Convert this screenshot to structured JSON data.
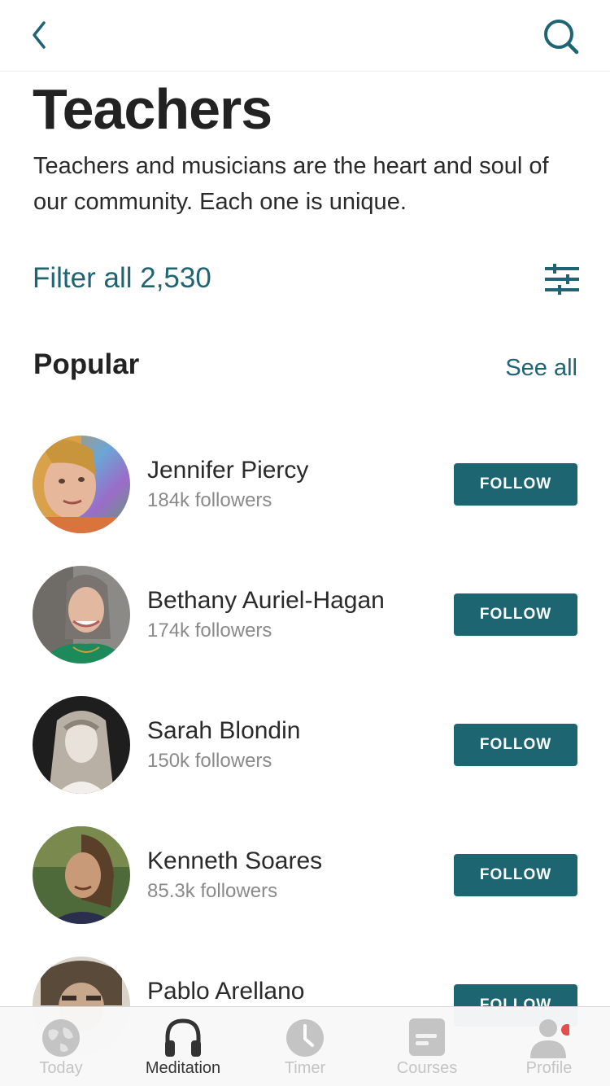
{
  "header": {
    "back_icon": "chevron-left-icon",
    "search_icon": "search-icon",
    "accent": "#1f6473"
  },
  "page": {
    "title": "Teachers",
    "description": "Teachers and musicians are the heart and soul of our community. Each one is unique."
  },
  "filter": {
    "label": "Filter all 2,530",
    "icon": "sliders-icon"
  },
  "popular": {
    "title": "Popular",
    "see_all": "See all",
    "teachers": [
      {
        "name": "Jennifer Piercy",
        "followers": "184k followers",
        "follow_label": "FOLLOW"
      },
      {
        "name": "Bethany Auriel-Hagan",
        "followers": "174k followers",
        "follow_label": "FOLLOW"
      },
      {
        "name": "Sarah Blondin",
        "followers": "150k followers",
        "follow_label": "FOLLOW"
      },
      {
        "name": "Kenneth Soares",
        "followers": "85.3k followers",
        "follow_label": "FOLLOW"
      },
      {
        "name": "Pablo Arellano",
        "followers": "",
        "follow_label": "FOLLOW"
      }
    ]
  },
  "tabbar": {
    "tabs": [
      {
        "label": "Today",
        "icon": "globe-icon",
        "active": false
      },
      {
        "label": "Meditation",
        "icon": "headphones-icon",
        "active": true
      },
      {
        "label": "Timer",
        "icon": "clock-icon",
        "active": false
      },
      {
        "label": "Courses",
        "icon": "courses-icon",
        "active": false
      },
      {
        "label": "Profile",
        "icon": "profile-icon",
        "active": false,
        "badge": true
      }
    ],
    "badge_color": "#e84c4c"
  }
}
